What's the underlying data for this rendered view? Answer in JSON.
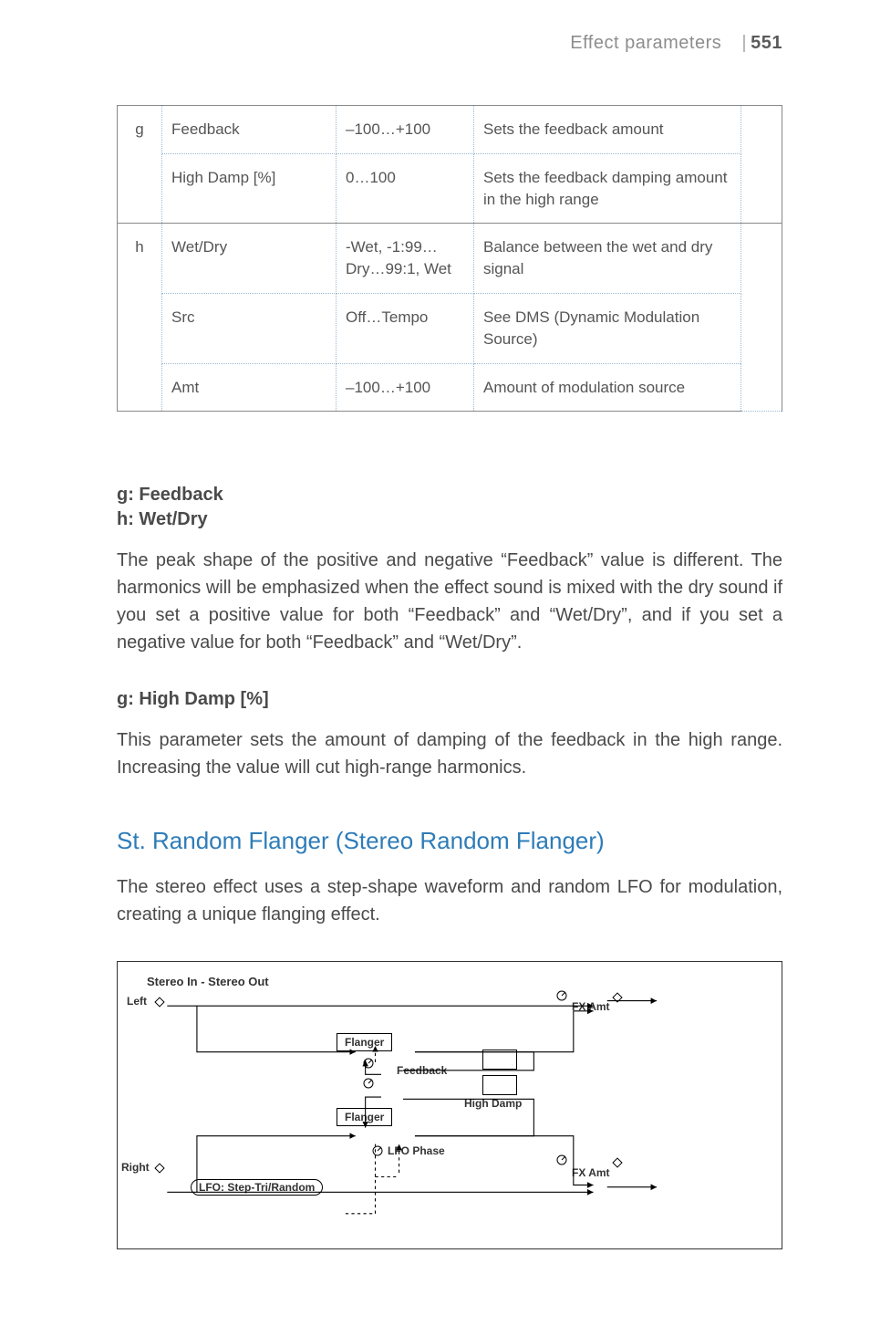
{
  "header": {
    "section": "Effect parameters",
    "separator": "|",
    "page": "551"
  },
  "rows": [
    {
      "marker": "g",
      "name": "Feedback",
      "range": "–100…+100",
      "desc": "Sets the feedback amount",
      "groupTop": true,
      "hasMarker": true,
      "groupBot": false
    },
    {
      "marker": "",
      "name": "High Damp [%]",
      "range": "0…100",
      "desc": "Sets the feedback damping amount in the high range",
      "groupTop": false,
      "hasMarker": false,
      "groupBot": true
    },
    {
      "marker": "h",
      "name": "Wet/Dry",
      "range": "-Wet, -1:99…Dry…99:1, Wet",
      "desc": "Balance between the wet and dry signal",
      "groupTop": true,
      "hasMarker": true,
      "groupBot": false
    },
    {
      "marker": "",
      "name": "Src",
      "range": "Off…Tempo",
      "desc": "See DMS (Dynamic Modulation Source)",
      "groupTop": false,
      "hasMarker": false,
      "groupBot": false
    },
    {
      "marker": "",
      "name": "Amt",
      "range": "–100…+100",
      "desc": "Amount of modulation source",
      "groupTop": false,
      "hasMarker": false,
      "groupBot": true
    }
  ],
  "prose": {
    "h1": "g: Feedback",
    "h2": "h: Wet/Dry",
    "p1": "The peak shape of the positive and negative “Feedback” value is different. The harmonics will be emphasized when the effect sound is mixed with the dry sound if you set a positive value for both “Feedback” and “Wet/Dry”, and if you set a negative value for both “Feedback” and “Wet/Dry”.",
    "h3": "g: High Damp [%]",
    "p2": "This parameter sets the amount of damping of the feedback in the high range. Increasing the value will cut high-range harmonics."
  },
  "section": {
    "title": "St. Random Flanger (Stereo Random Flanger)",
    "desc": "The stereo effect uses a step-shape waveform and random LFO for modulation, creating a unique flanging effect."
  },
  "diagram": {
    "title": "Stereo In - Stereo Out",
    "left": "Left",
    "right": "Right",
    "flanger": "Flanger",
    "feedback": "Feedback",
    "highdamp": "High Damp",
    "fxamt": "FX Amt",
    "lfophase": "LFO Phase",
    "lfo": "LFO: Step-Tri/Random"
  }
}
